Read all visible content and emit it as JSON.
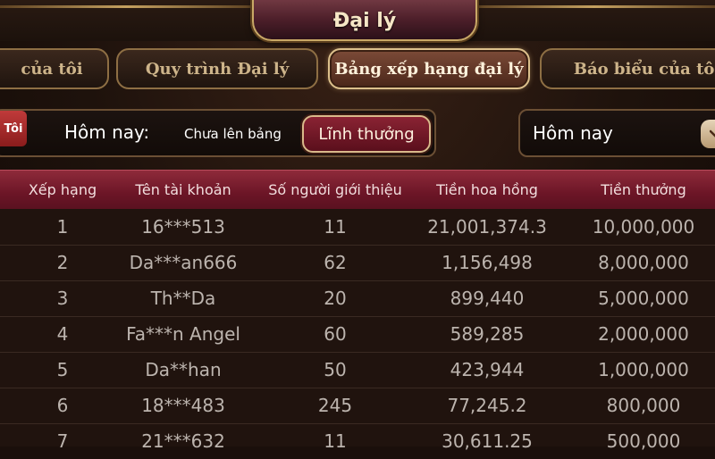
{
  "window": {
    "title": "Đại lý"
  },
  "tabs": [
    {
      "label": "của tôi",
      "active": false
    },
    {
      "label": "Quy trình Đại lý",
      "active": false
    },
    {
      "label": "Bảng xếp hạng đại lý",
      "active": true
    },
    {
      "label": "Báo biểu của tôi",
      "active": false
    }
  ],
  "filter": {
    "badge": "Tôi",
    "period_label": "Hôm nay:",
    "status": "Chưa lên bảng",
    "claim_button": "Lĩnh thưởng",
    "date_select_value": "Hôm nay"
  },
  "table": {
    "columns": [
      "Xếp hạng",
      "Tên tài khoản",
      "Số người giới thiệu",
      "Tiền hoa hồng",
      "Tiền thưởng"
    ],
    "rows": [
      [
        "1",
        "16***513",
        "11",
        "21,001,374.3",
        "10,000,000"
      ],
      [
        "2",
        "Da***an666",
        "62",
        "1,156,498",
        "8,000,000"
      ],
      [
        "3",
        "Th**Da",
        "20",
        "899,440",
        "5,000,000"
      ],
      [
        "4",
        "Fa***n Angel",
        "60",
        "589,285",
        "2,000,000"
      ],
      [
        "5",
        "Da**han",
        "50",
        "423,944",
        "1,000,000"
      ],
      [
        "6",
        "18***483",
        "245",
        "77,245.2",
        "800,000"
      ],
      [
        "7",
        "21***632",
        "11",
        "30,611.25",
        "500,000"
      ]
    ]
  },
  "colors": {
    "accent_gold": "#c9a866",
    "header_red": "#7a1c2c",
    "claim_button": "#7a1a2a"
  }
}
